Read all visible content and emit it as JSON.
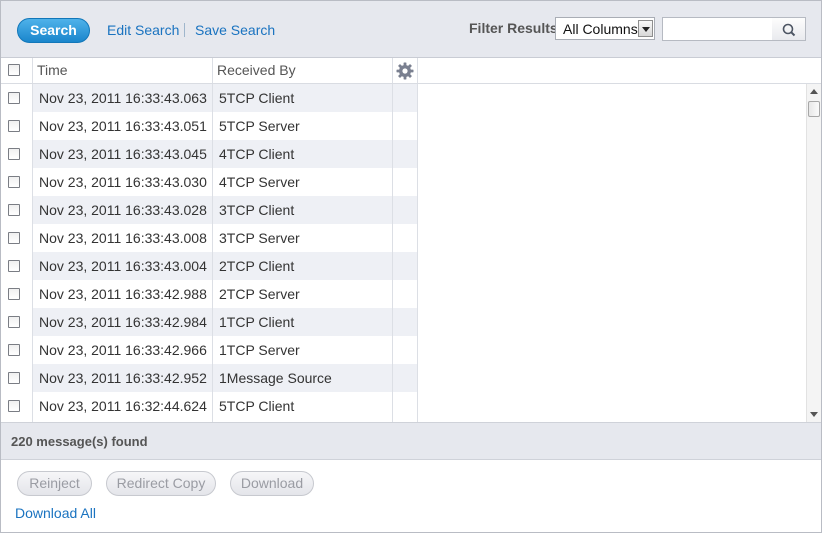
{
  "toolbar": {
    "search_label": "Search",
    "edit_search_label": "Edit Search",
    "save_search_label": "Save Search",
    "filter_label": "Filter Results",
    "filter_select_value": "All Columns",
    "search_placeholder": ""
  },
  "table": {
    "columns": [
      "Time",
      "Received By"
    ],
    "rows": [
      {
        "time": "Nov 23, 2011 16:33:43.063",
        "received_by": "5TCP Client"
      },
      {
        "time": "Nov 23, 2011 16:33:43.051",
        "received_by": "5TCP Server"
      },
      {
        "time": "Nov 23, 2011 16:33:43.045",
        "received_by": "4TCP Client"
      },
      {
        "time": "Nov 23, 2011 16:33:43.030",
        "received_by": "4TCP Server"
      },
      {
        "time": "Nov 23, 2011 16:33:43.028",
        "received_by": "3TCP Client"
      },
      {
        "time": "Nov 23, 2011 16:33:43.008",
        "received_by": "3TCP Server"
      },
      {
        "time": "Nov 23, 2011 16:33:43.004",
        "received_by": "2TCP Client"
      },
      {
        "time": "Nov 23, 2011 16:33:42.988",
        "received_by": "2TCP Server"
      },
      {
        "time": "Nov 23, 2011 16:33:42.984",
        "received_by": "1TCP Client"
      },
      {
        "time": "Nov 23, 2011 16:33:42.966",
        "received_by": "1TCP Server"
      },
      {
        "time": "Nov 23, 2011 16:33:42.952",
        "received_by": "1Message Source"
      },
      {
        "time": "Nov 23, 2011 16:32:44.624",
        "received_by": "5TCP Client"
      }
    ]
  },
  "status": {
    "found_text": "220 message(s) found"
  },
  "actions": {
    "reject_label": "Reinject",
    "redirect_label": "Redirect Copy",
    "download_label": "Download",
    "download_all_label": "Download All"
  },
  "icons": {
    "settings": "gear-icon",
    "search": "magnifier-icon",
    "dropdown": "chevron-down-icon"
  },
  "colors": {
    "accent": "#1a86cc",
    "link": "#1a73c0",
    "toolbar_bg": "#e6e8ee",
    "row_alt_bg": "#eef0f5"
  }
}
